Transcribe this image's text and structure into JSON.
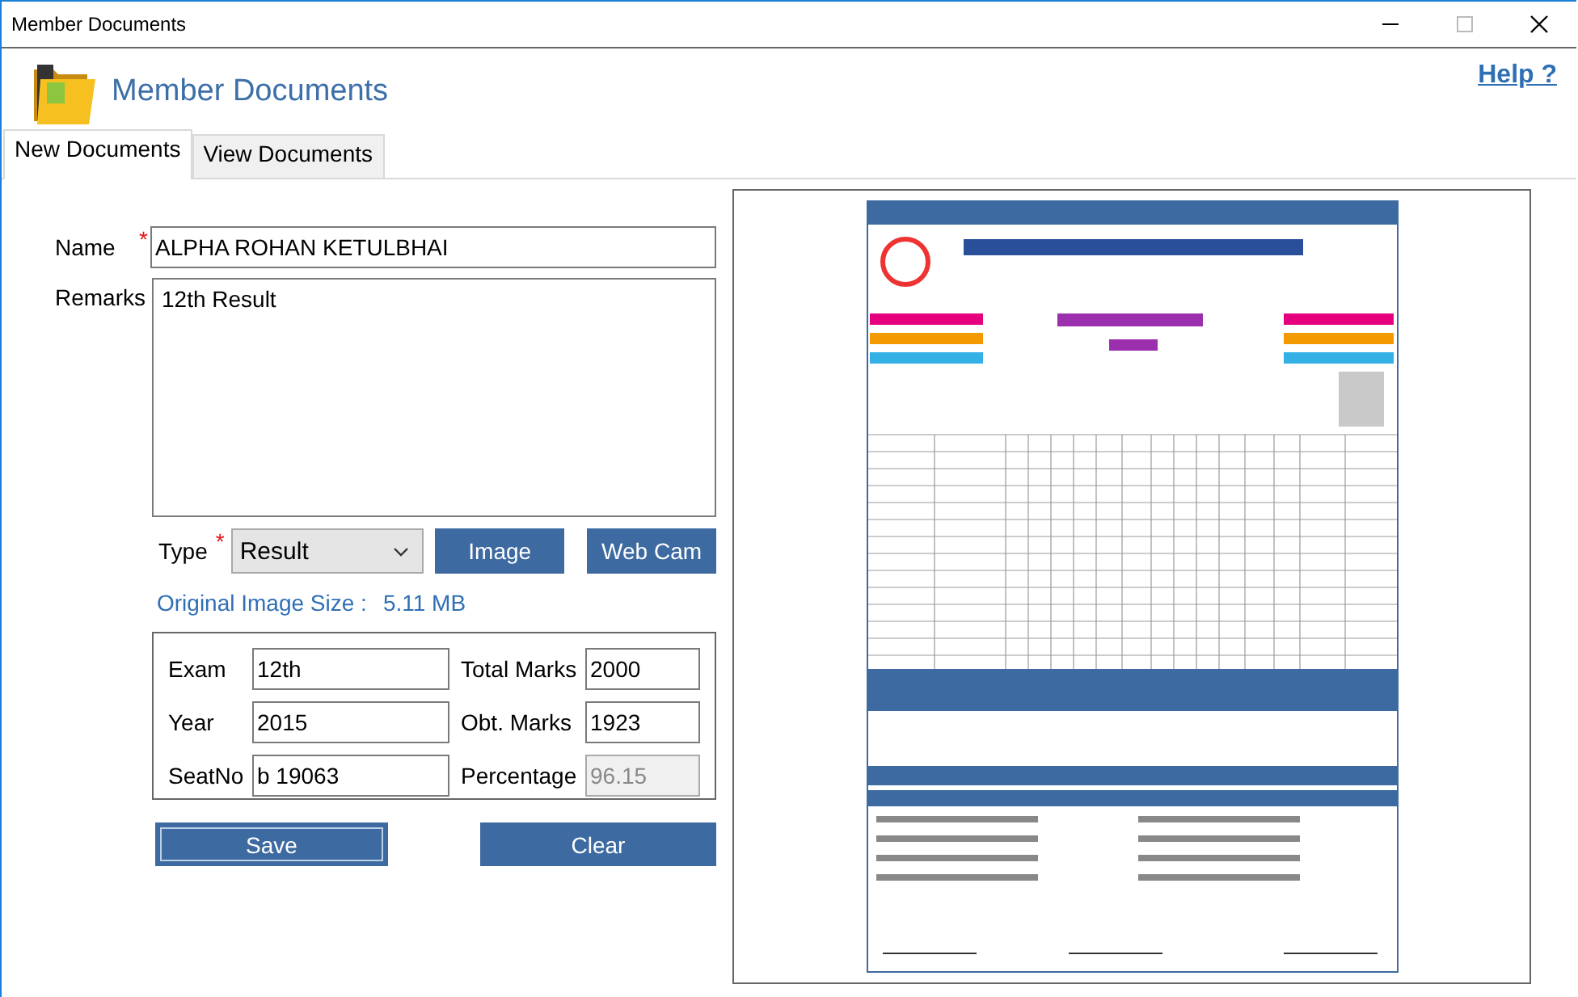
{
  "window": {
    "title": "Member Documents"
  },
  "header": {
    "title": "Member Documents",
    "help_link": "Help ?"
  },
  "tabs": [
    {
      "label": "New Documents",
      "selected": true
    },
    {
      "label": "View Documents",
      "selected": false
    }
  ],
  "form": {
    "name": {
      "label": "Name",
      "required_mark": "*",
      "value": "ALPHA ROHAN KETULBHAI"
    },
    "remarks": {
      "label": "Remarks",
      "value": "12th Result"
    },
    "type": {
      "label": "Type",
      "required_mark": "*",
      "value": "Result"
    },
    "source_buttons": [
      "Image",
      "Web Cam"
    ],
    "image_size": {
      "label": "Original Image Size :",
      "value": "5.11 MB"
    },
    "details": [
      {
        "label": "Exam",
        "value": "12th",
        "disabled": false
      },
      {
        "label": "Total Marks",
        "value": "2000",
        "disabled": false
      },
      {
        "label": "Year",
        "value": "2015",
        "disabled": false
      },
      {
        "label": "Obt. Marks",
        "value": "1923",
        "disabled": false
      },
      {
        "label": "SeatNo",
        "value": "b 19063",
        "disabled": false
      },
      {
        "label": "Percentage",
        "value": "96.15",
        "disabled": true
      }
    ],
    "actions": [
      {
        "label": "Save",
        "focused": true
      },
      {
        "label": "Clear",
        "focused": false
      }
    ]
  }
}
